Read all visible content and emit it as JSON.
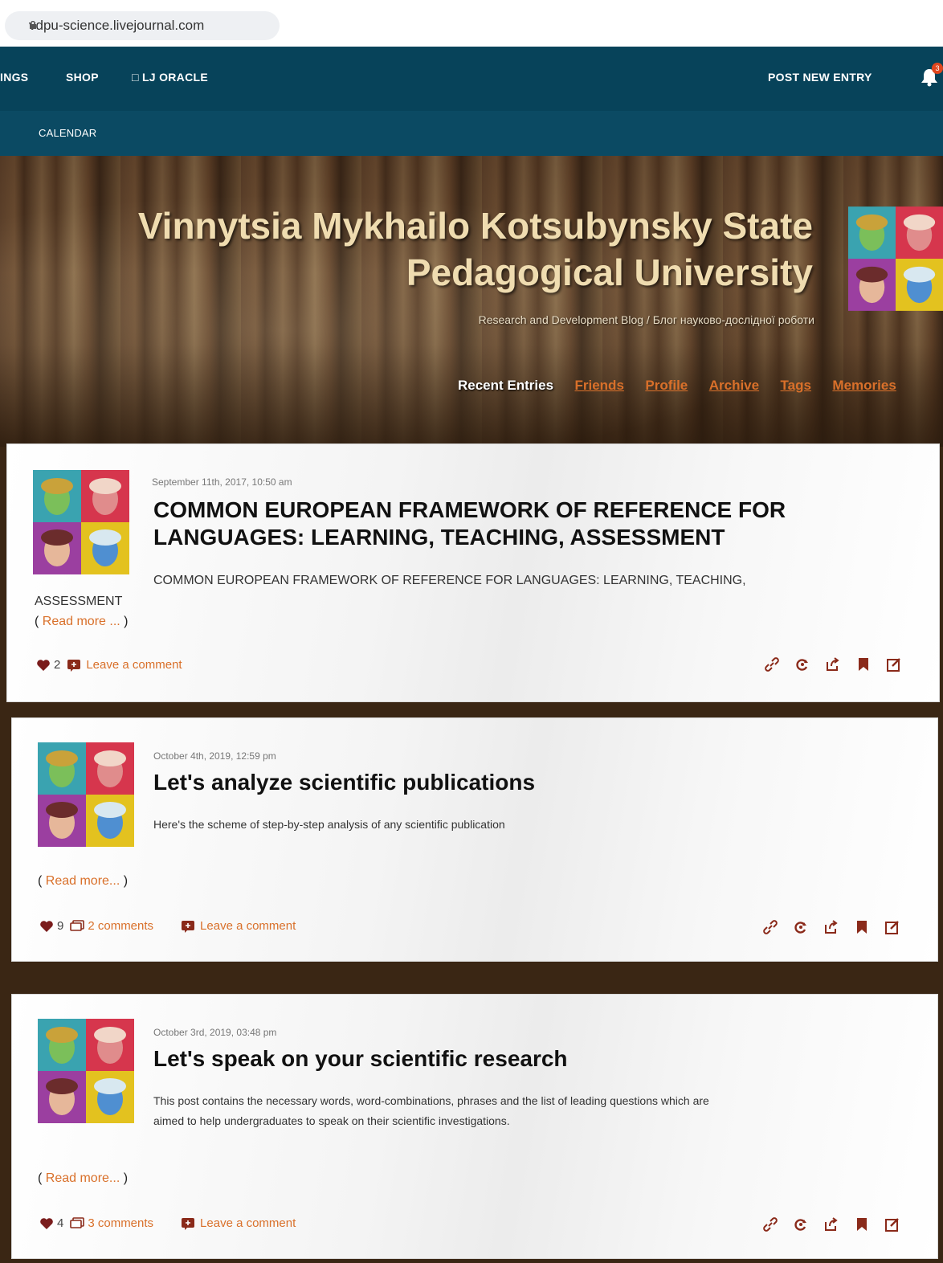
{
  "browser": {
    "url": "vdpu-science.livejournal.com"
  },
  "topnav": {
    "items": [
      "INGS",
      "SHOP",
      "□ LJ ORACLE"
    ],
    "post_new_entry": "POST NEW ENTRY",
    "notification_count": "3"
  },
  "subnav": {
    "calendar": "CALENDAR"
  },
  "header": {
    "title_line1": "Vinnytsia Mykhailo Kotsubynsky State",
    "title_line2": "Pedagogical University",
    "subtitle": "Research and Development Blog / Блог науково-дослідної роботи",
    "nav": [
      "Recent Entries",
      "Friends",
      "Profile",
      "Archive",
      "Tags",
      "Memories"
    ]
  },
  "posts": [
    {
      "date": "September 11th, 2017, 10:50 am",
      "title_line1": "COMMON EUROPEAN FRAMEWORK OF REFERENCE FOR",
      "title_line2": "LANGUAGES: LEARNING, TEACHING, ASSESSMENT",
      "text_line1": "COMMON EUROPEAN FRAMEWORK OF REFERENCE FOR LANGUAGES: LEARNING, TEACHING,",
      "text_line2": "ASSESSMENT",
      "read_more_open": "( ",
      "read_more": "Read more ...",
      "read_more_close": " )",
      "likes": "2",
      "comments_link": "",
      "leave_comment": "Leave a comment"
    },
    {
      "date": "October 4th, 2019, 12:59 pm",
      "title": "Let's analyze scientific publications",
      "text_line1": "Here's the scheme of step-by-step analysis of any scientific publication",
      "read_more_open": "( ",
      "read_more": "Read more...",
      "read_more_close": " )",
      "likes": "9",
      "comments_link": "2 comments",
      "leave_comment": "Leave a comment"
    },
    {
      "date": "October 3rd, 2019, 03:48 pm",
      "title": "Let's speak on your scientific research",
      "text_line1": "This post contains the necessary words, word-combinations, phrases and the list of leading questions which are",
      "text_line2": "aimed to help undergraduates to speak on their scientific investigations.",
      "read_more_open": "( ",
      "read_more": "Read more...",
      "read_more_close": " )",
      "likes": "4",
      "comments_link": "3 comments",
      "leave_comment": "Leave a comment"
    }
  ],
  "icons": {
    "colors": {
      "accent": "#d9702a",
      "heart": "#7a1c1c",
      "nav_bg": "#07435a",
      "action": "#8a2a1a"
    }
  }
}
